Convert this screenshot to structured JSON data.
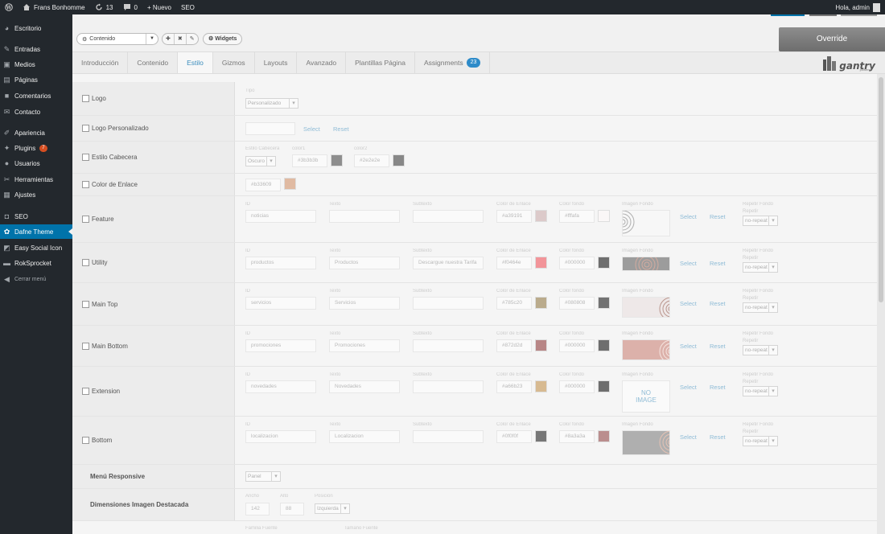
{
  "adminbar": {
    "site_name": "Frans Bonhomme",
    "updates": "13",
    "comments": "0",
    "new_label": "+ Nuevo",
    "seo_label": "SEO",
    "greeting": "Hola, admin"
  },
  "sidebar": {
    "items": [
      {
        "label": "Escritorio",
        "icon": "dashboard-icon",
        "glyph": "◕"
      },
      {
        "label": "Entradas",
        "icon": "pin-icon",
        "glyph": "✎"
      },
      {
        "label": "Medios",
        "icon": "media-icon",
        "glyph": "▣"
      },
      {
        "label": "Páginas",
        "icon": "pages-icon",
        "glyph": "▤"
      },
      {
        "label": "Comentarios",
        "icon": "comments-icon",
        "glyph": "■"
      },
      {
        "label": "Contacto",
        "icon": "mail-icon",
        "glyph": "✉"
      },
      {
        "label": "Apariencia",
        "icon": "brush-icon",
        "glyph": "✐"
      },
      {
        "label": "Plugins",
        "icon": "plugin-icon",
        "glyph": "✦",
        "badge": "7"
      },
      {
        "label": "Usuarios",
        "icon": "users-icon",
        "glyph": "●"
      },
      {
        "label": "Herramientas",
        "icon": "wrench-icon",
        "glyph": "✂"
      },
      {
        "label": "Ajustes",
        "icon": "settings-icon",
        "glyph": "▦"
      },
      {
        "label": "SEO",
        "icon": "seo-icon",
        "glyph": "◘"
      },
      {
        "label": "Dafne Theme",
        "icon": "gear-icon",
        "glyph": "✿",
        "active": true
      },
      {
        "label": "Easy Social Icon",
        "icon": "share-icon",
        "glyph": "◩"
      },
      {
        "label": "RokSprocket",
        "icon": "sprocket-icon",
        "glyph": "▬"
      },
      {
        "label": "Cerrar menú",
        "icon": "collapse-icon",
        "glyph": "◀",
        "small": true
      }
    ]
  },
  "toolbar": {
    "context_select": "Contenido",
    "widgets_label": "Widgets",
    "override_label": "Override"
  },
  "tabs": [
    {
      "label": "Introducción"
    },
    {
      "label": "Contenido"
    },
    {
      "label": "Estilo",
      "active": true
    },
    {
      "label": "Gizmos"
    },
    {
      "label": "Layouts"
    },
    {
      "label": "Avanzado"
    },
    {
      "label": "Plantillas Página"
    },
    {
      "label": "Assignments",
      "badge": "23"
    }
  ],
  "gantry": {
    "name": "gantry",
    "sub": "powered"
  },
  "labels": {
    "tipo": "Tipo",
    "estilo_cabecera": "Estilo Cabecera",
    "color1": "color1",
    "color2": "color2",
    "id": "ID",
    "texto": "Texto",
    "subtexto": "Subtexto",
    "color_enlace": "Color de Enlace",
    "color_fondo": "Color fondo",
    "imagen_fondo": "Imagen Fondo",
    "repetir_fondo": "Repetir Fondo",
    "repetir": "Repetir",
    "select": "Select",
    "reset": "Reset",
    "ancho": "Ancho",
    "alto": "Alto",
    "posicion": "Posición",
    "familia_fuente": "Familia Fuente",
    "tamano_fuente": "Tamaño Fuente",
    "no_image": "NO IMAGE"
  },
  "logo": {
    "label": "Logo",
    "tipo": "Personalizado"
  },
  "logo_personalizado": {
    "label": "Logo Personalizado"
  },
  "estilo_cabecera": {
    "label": "Estilo Cabecera",
    "value": "Oscuro",
    "color1": "#3b3b3b",
    "color2": "#2e2e2e"
  },
  "color_enlace": {
    "label": "Color de Enlace",
    "value": "#b33609",
    "swatch": "#d08a60"
  },
  "sections": [
    {
      "label": "Feature",
      "id": "noticias",
      "texto": "",
      "subtexto": "",
      "link": "#a39191",
      "link_swatch": "#c9a7a7",
      "bg": "#fffafa",
      "bg_swatch": "#fffafa",
      "repeat": "no-repeat",
      "image": "arc-light"
    },
    {
      "label": "Utility",
      "id": "productos",
      "texto": "Productos",
      "subtexto": "Descargue nuestra Tarifa",
      "link": "#f0464e",
      "link_swatch": "#f0464e",
      "bg": "#000000",
      "bg_swatch": "#000000",
      "repeat": "no-repeat",
      "image": "arc-dark"
    },
    {
      "label": "Main Top",
      "id": "servicios",
      "texto": "Servicios",
      "subtexto": "",
      "link": "#785c20",
      "link_swatch": "#8a7038",
      "bg": "#080808",
      "bg_swatch": "#080808",
      "repeat": "no-repeat",
      "image": "arc-pink"
    },
    {
      "label": "Main Bottom",
      "id": "promociones",
      "texto": "Promociones",
      "subtexto": "",
      "link": "#872d2d",
      "link_swatch": "#872d2d",
      "bg": "#000000",
      "bg_swatch": "#000000",
      "repeat": "no-repeat",
      "image": "arc-red"
    },
    {
      "label": "Extension",
      "id": "novedades",
      "texto": "Novedades",
      "subtexto": "",
      "link": "#a66b23",
      "link_swatch": "#c08a40",
      "bg": "#000000",
      "bg_swatch": "#000000",
      "repeat": "no-repeat",
      "image": "none"
    },
    {
      "label": "Bottom",
      "id": "localizacion",
      "texto": "Localizacion",
      "subtexto": "",
      "link": "#0f0f0f",
      "link_swatch": "#0f0f0f",
      "bg": "#8a3a3a",
      "bg_swatch": "#8a3a3a",
      "repeat": "no-repeat",
      "image": "arc-gray"
    }
  ],
  "menu_responsive": {
    "label": "Menú Responsive",
    "value": "Panel"
  },
  "dimensiones": {
    "label": "Dimensiones Imagen Destacada",
    "ancho": "142",
    "alto": "88",
    "posicion": "Izquierda"
  }
}
